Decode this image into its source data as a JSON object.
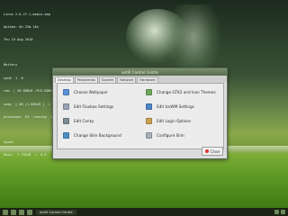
{
  "conky": {
    "lines": [
      "Linux 2.6.27-1-mepis-smp",
      "Uptime: 0h 23m 16s",
      "Thu 19 Aug 2010",
      "",
      "Battery",
      "cpu0  1  0",
      "ram  [ 58.88MiB /913.80MiB ]  =  1  0",
      "swap  [ 0B /1.86GiB ]  =  0  0",
      "processes  61  running  1",
      "",
      "Speed",
      "Down:  7.75KiB  =  0.0"
    ]
  },
  "window": {
    "title": "antiX Control Centre",
    "tabs": [
      "Desktop",
      "Peripherals",
      "System",
      "Network",
      "Hardware"
    ],
    "active_tab": "Desktop",
    "items": [
      {
        "label": "Choose Wallpaper",
        "icon": "wallpaper-icon",
        "color": "#5a8fd6"
      },
      {
        "label": "Change GTK2 and Icon Themes",
        "icon": "theme-icon",
        "color": "#6fa85a"
      },
      {
        "label": "Edit Fluxbox Settings",
        "icon": "fluxbox-icon",
        "color": "#9aa3b3"
      },
      {
        "label": "Edit IceWM Settings",
        "icon": "icewm-icon",
        "color": "#4a86c8"
      },
      {
        "label": "Edit Conky",
        "icon": "conky-icon",
        "color": "#7d8c96"
      },
      {
        "label": "Edit Login Options",
        "icon": "login-icon",
        "color": "#c8a04a"
      },
      {
        "label": "Change Slim Background",
        "icon": "slim-icon",
        "color": "#4f8fc6"
      },
      {
        "label": "Configure Slim",
        "icon": "configure-icon",
        "color": "#a7b0ba"
      }
    ],
    "close_label": "Close"
  },
  "taskbar": {
    "active_window": "antiX Control Centre"
  },
  "colors": {
    "titlebar": "#586b4a",
    "window_bg": "#dcdcdc",
    "taskbar_bg": "#1c2315"
  }
}
